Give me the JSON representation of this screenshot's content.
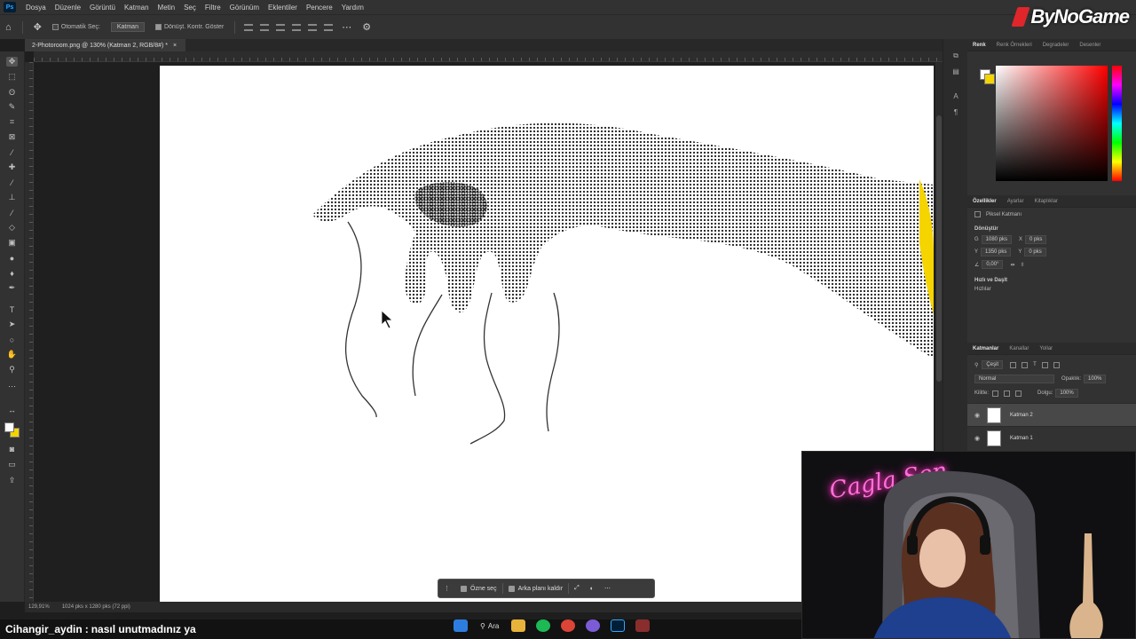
{
  "menubar": {
    "logo": "Ps",
    "items": [
      "Dosya",
      "Düzenle",
      "Görüntü",
      "Katman",
      "Metin",
      "Seç",
      "Filtre",
      "Görünüm",
      "Eklentiler",
      "Pencere",
      "Yardım"
    ]
  },
  "options": {
    "auto_select_label": "Otomatik Seç:",
    "auto_select_value": "Katman",
    "transform_controls_label": "Dönüşt. Kontr. Göster"
  },
  "channel_logo": "ByNoGame",
  "document": {
    "tab_title": "2-Photoroom.png @ 130% (Katman 2, RGB/8#) *"
  },
  "status": {
    "zoom": "129,91%",
    "dimensions": "1024 pks x 1280 pks (72 ppi)"
  },
  "context_bar": {
    "select_subject": "Özne seç",
    "remove_background": "Arka planı kaldır"
  },
  "panels": {
    "color_tabs": [
      "Renk",
      "Renk Örnekleri",
      "Degradeler",
      "Desenler"
    ],
    "properties_tabs": [
      "Özellikler",
      "Ayarlar",
      "Kitaplıklar"
    ],
    "pixel_layer_label": "Piksel Katmanı",
    "transform_label": "Dönüştür",
    "width_label": "G",
    "width_value": "1080 pks",
    "height_label": "Y",
    "height_value": "1350 pks",
    "x_label": "X",
    "x_value": "0 pks",
    "y_label": "Y",
    "y_value": "0 pks",
    "angle_value": "0,00°",
    "quick_actions_label": "Hızlı ve Daşlt",
    "quick_actions_sub": "Hızlılar",
    "layers_tabs": [
      "Katmanlar",
      "Kanallar",
      "Yollar"
    ],
    "layer_filter": "Çeşit",
    "blend_mode": "Normal",
    "opacity_label": "Opaklık:",
    "opacity_value": "100%",
    "lock_label": "Kilitle:",
    "fill_label": "Dolgu:",
    "fill_value": "100%",
    "layers": [
      {
        "name": "Katman 2",
        "selected": true
      },
      {
        "name": "Katman 1",
        "selected": false
      }
    ]
  },
  "webcam": {
    "neon_sign": "Cagla Sen"
  },
  "chat": {
    "user": "Cihangir_aydin",
    "separator": ":",
    "message": "nasıl unutmadınız ya"
  },
  "win_taskbar": {
    "search_label": "Ara"
  },
  "colors": {
    "accent_yellow": "#f5d400",
    "ui_dark": "#323232",
    "chat_bg": "#121212",
    "neon_pink": "#ff6fd8"
  }
}
